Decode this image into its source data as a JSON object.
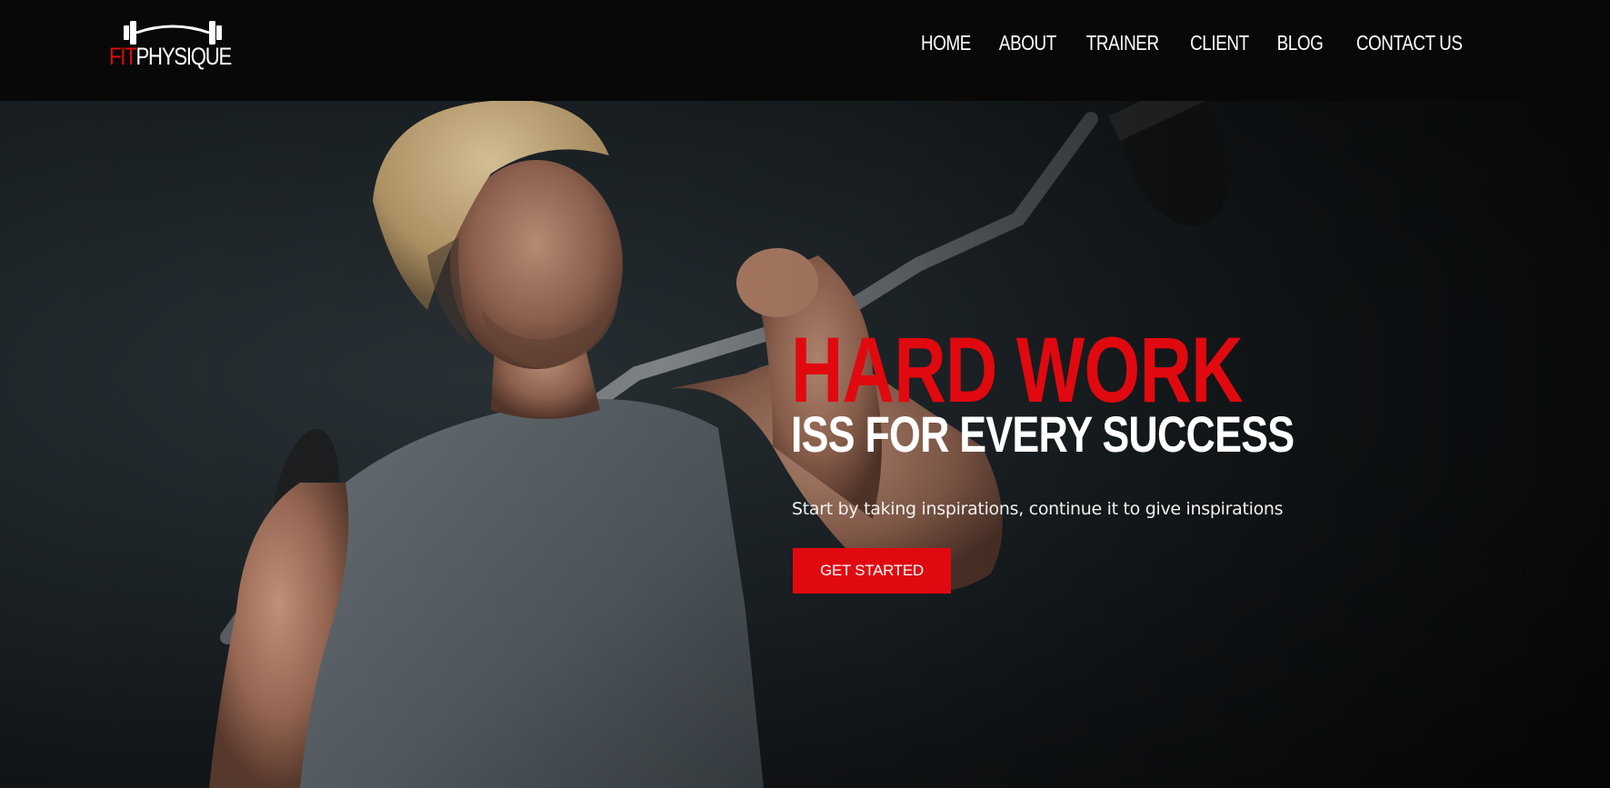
{
  "brand": {
    "name_part1": "FIT",
    "name_part2": "PHYSIQUE",
    "accent_color": "#e0090f",
    "icon": "barbell-icon"
  },
  "nav": {
    "items": [
      {
        "label": "HOME"
      },
      {
        "label": "ABOUT"
      },
      {
        "label": "TRAINER"
      },
      {
        "label": "CLIENT"
      },
      {
        "label": "BLOG"
      },
      {
        "label": "CONTACT US"
      }
    ]
  },
  "hero": {
    "headline": "HARD WORK",
    "subheadline": "ISS FOR EVERY SUCCESS",
    "tagline": "Start by taking inspirations, continue it to give inspirations",
    "cta_label": "GET STARTED",
    "image": "man-lifting-barbell-photo"
  }
}
